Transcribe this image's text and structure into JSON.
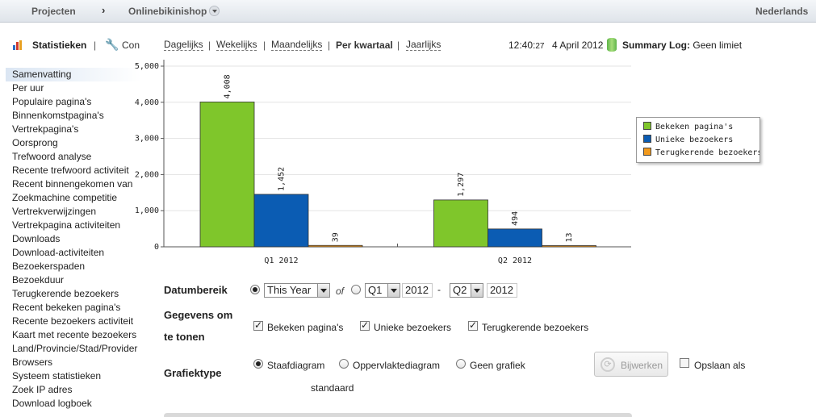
{
  "topbar": {
    "projects": "Projecten",
    "separator": "›",
    "project_name": "Onlinebikinishop",
    "language": "Nederlands"
  },
  "toolbar": {
    "statistics": "Statistieken",
    "separator": "|",
    "config": "Con"
  },
  "sidebar": {
    "items": [
      "Samenvatting",
      "Per uur",
      "Populaire pagina's",
      "Binnenkomstpagina's",
      "Vertrekpagina's",
      "Oorsprong",
      "Trefwoord analyse",
      "Recente trefwoord activiteit",
      "Recent binnengekomen van",
      "Zoekmachine competitie",
      "Vertrekverwijzingen",
      "Vertrekpagina activiteiten",
      "Downloads",
      "Download-activiteiten",
      "Bezoekerspaden",
      "Bezoekduur",
      "Terugkerende bezoekers",
      "Recent bekeken pagina's",
      "Recente bezoekers activiteit",
      "Kaart met recente bezoekers",
      "Land/Provincie/Stad/Provider",
      "Browsers",
      "Systeem statistieken",
      "Zoek IP adres",
      "Download logboek"
    ]
  },
  "periods": {
    "daily": "Dagelijks",
    "weekly": "Wekelijks",
    "monthly": "Maandelijks",
    "quarterly": "Per kwartaal",
    "yearly": "Jaarlijks",
    "separator": "|"
  },
  "status": {
    "time": "12:40:",
    "seconds": "27",
    "date": "4 April 2012",
    "summary_label": "Summary Log:",
    "summary_value": "Geen limiet"
  },
  "chart_data": {
    "type": "bar",
    "categories": [
      "Q1 2012",
      "Q2 2012"
    ],
    "series": [
      {
        "name": "Bekeken pagina's",
        "values": [
          4008,
          1297
        ],
        "color": "#7fc62b"
      },
      {
        "name": "Unieke bezoekers",
        "values": [
          1452,
          494
        ],
        "color": "#0b5cb3"
      },
      {
        "name": "Terugkerende bezoekers",
        "values": [
          39,
          13
        ],
        "color": "#f29a1d"
      }
    ],
    "data_labels": [
      [
        "4,008",
        "1,452",
        "39"
      ],
      [
        "1,297",
        "494",
        "13"
      ]
    ],
    "y_ticks": [
      "0",
      "1,000",
      "2,000",
      "3,000",
      "4,000",
      "5,000"
    ],
    "ylim": [
      0,
      5000
    ],
    "grid": true,
    "legend": "right"
  },
  "form": {
    "date_range_label": "Datumbereik",
    "date_range_select": "This Year",
    "of_label": "of",
    "from_quarter": "Q1",
    "from_year": "2012",
    "range_dash": "-",
    "to_quarter": "Q2",
    "to_year": "2012",
    "data_label_line1": "Gegevens om",
    "data_label_line2": "te tonen",
    "check_pageviews": "Bekeken pagina's",
    "check_unique": "Unieke bezoekers",
    "check_returning": "Terugkerende bezoekers",
    "chart_type_label": "Grafiektype",
    "type_bar": "Staafdiagram",
    "type_area": "Oppervlaktediagram",
    "type_none": "Geen grafiek",
    "type_default": "standaard",
    "update_button": "Bijwerken",
    "save_as": "Opslaan als"
  }
}
